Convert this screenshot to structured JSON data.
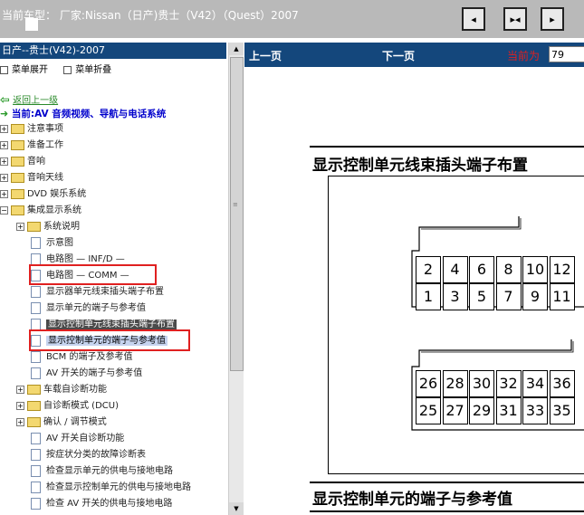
{
  "topbar": {
    "title": "当前车型：  厂家:Nissan（日产)贵士（V42）（Quest）2007",
    "buttons": [
      {
        "name": "first-page-button",
        "glyph": "◂"
      },
      {
        "name": "sync-button",
        "glyph": "▸◂"
      },
      {
        "name": "last-page-button",
        "glyph": "▸"
      }
    ]
  },
  "left": {
    "header": "日产--贵士(V42)-2007",
    "expand_label": "菜单展开",
    "collapse_label": "菜单折叠",
    "back_label": "返回上一级",
    "current_label": "当前:AV 音频视频、导航与电话系统",
    "tree": [
      {
        "label": "注意事项",
        "kind": "folder"
      },
      {
        "label": "准备工作",
        "kind": "folder"
      },
      {
        "label": "音响",
        "kind": "folder"
      },
      {
        "label": "音响天线",
        "kind": "folder"
      },
      {
        "label": "DVD 娱乐系统",
        "kind": "folder"
      },
      {
        "label": "集成显示系统",
        "kind": "folder-open"
      },
      {
        "label": "系统说明",
        "kind": "subfolder"
      },
      {
        "label": "示意图",
        "kind": "doc"
      },
      {
        "label": "电路图 — INF/D —",
        "kind": "doc"
      },
      {
        "label": "电路图 — COMM —",
        "kind": "doc"
      },
      {
        "label": "显示器单元线束插头端子布置",
        "kind": "doc"
      },
      {
        "label": "显示单元的端子与参考值",
        "kind": "doc"
      },
      {
        "label": "显示控制单元线束插头端子布置",
        "kind": "doc-selected"
      },
      {
        "label": "显示控制单元的端子与参考值",
        "kind": "doc-highlight"
      },
      {
        "label": "BCM 的端子及参考值",
        "kind": "doc"
      },
      {
        "label": "AV 开关的端子与参考值",
        "kind": "doc"
      },
      {
        "label": "车载自诊断功能",
        "kind": "subfolder"
      },
      {
        "label": "自诊断模式 (DCU)",
        "kind": "subfolder"
      },
      {
        "label": "确认 / 调节模式",
        "kind": "subfolder"
      },
      {
        "label": "AV 开关自诊断功能",
        "kind": "doc"
      },
      {
        "label": "按症状分类的故障诊断表",
        "kind": "doc"
      },
      {
        "label": "检查显示单元的供电与接地电路",
        "kind": "doc"
      },
      {
        "label": "检查显示控制单元的供电与接地电路",
        "kind": "doc"
      },
      {
        "label": "检查 AV 开关的供电与接地电路",
        "kind": "doc"
      }
    ]
  },
  "right": {
    "prev_label": "上一页",
    "next_label": "下一页",
    "current_page_label": "当前为",
    "current_page_value": "79",
    "section1_title": "显示控制单元线束插头端子布置",
    "section2_title": "显示控制单元的端子与参考值",
    "connector1_top": [
      "2",
      "4",
      "6",
      "8",
      "10",
      "12"
    ],
    "connector1_bottom": [
      "1",
      "3",
      "5",
      "7",
      "9",
      "11"
    ],
    "connector2_top": [
      "26",
      "28",
      "30",
      "32",
      "34",
      "36"
    ],
    "connector2_bottom": [
      "25",
      "27",
      "29",
      "31",
      "33",
      "35"
    ]
  }
}
